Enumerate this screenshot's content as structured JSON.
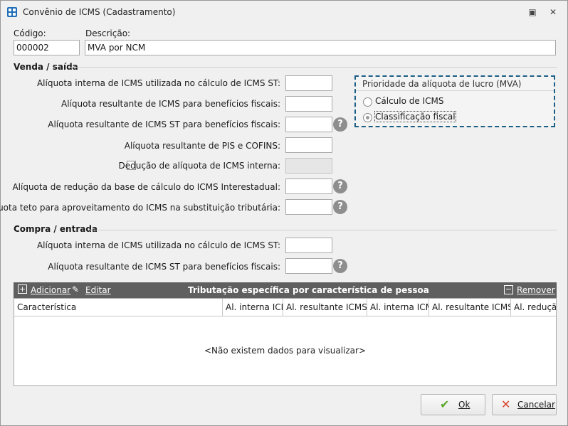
{
  "window": {
    "title": "Convênio de ICMS (Cadastramento)",
    "restore_icon": "▣",
    "close_icon": "✕"
  },
  "codigo": {
    "label": "Código:",
    "value": "000002"
  },
  "descricao": {
    "label": "Descrição:",
    "value": "MVA por NCM"
  },
  "venda": {
    "title": "Venda / saída",
    "rows": [
      "Alíquota interna de ICMS utilizada no cálculo de ICMS ST:",
      "Alíquota resultante de ICMS para benefícios fiscais:",
      "Alíquota resultante de ICMS ST para benefícios fiscais:",
      "Alíquota resultante de PIS e COFINS:",
      "Dedução de alíquota de ICMS interna:",
      "Alíquota de redução da base de cálculo do ICMS Interestadual:",
      "Alíquota teto para aproveitamento do ICMS na substituição tributária:"
    ]
  },
  "prioridade": {
    "title": "Prioridade da alíquota de lucro (MVA)",
    "options": [
      "Cálculo de ICMS",
      "Classificação fiscal"
    ],
    "selected": "Classificação fiscal"
  },
  "compra": {
    "title": "Compra / entrada",
    "rows": [
      "Alíquota interna de ICMS utilizada no cálculo de ICMS ST:",
      "Alíquota resultante de ICMS ST para benefícios fiscais:"
    ]
  },
  "grid": {
    "add": "Adicionar",
    "edit": "Editar",
    "title": "Tributação específica por característica de pessoa",
    "remove": "Remover",
    "columns": [
      "Característica",
      "Al. interna ICMS",
      "Al. resultante ICMS ST",
      "Al. interna ICMS",
      "Al. resultante ICMS ST",
      "Al. redução"
    ],
    "empty": "<Não existem dados para visualizar>"
  },
  "buttons": {
    "ok": "Ok",
    "cancel": "Cancelar"
  },
  "help_glyph": "?"
}
